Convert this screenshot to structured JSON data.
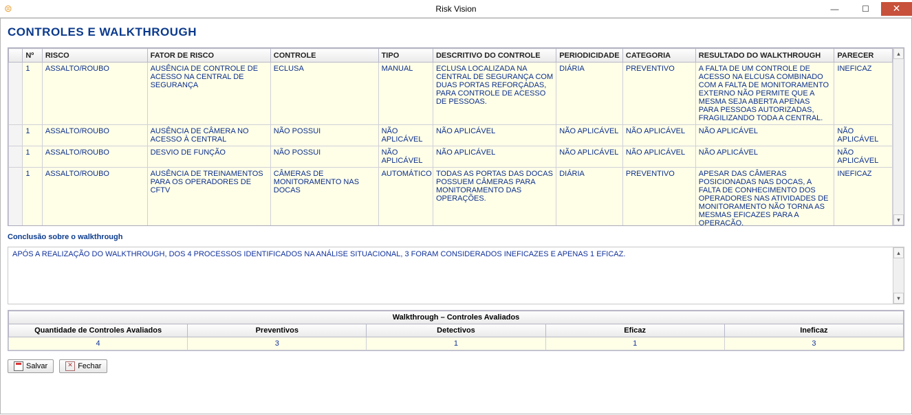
{
  "window": {
    "title": "Risk Vision"
  },
  "page": {
    "title": "CONTROLES E WALKTHROUGH"
  },
  "grid": {
    "headers": {
      "no": "Nº",
      "risco": "RISCO",
      "fator": "FATOR DE RISCO",
      "controle": "CONTROLE",
      "tipo": "TIPO",
      "descritivo": "DESCRITIVO DO CONTROLE",
      "periodicidade": "PERIODICIDADE",
      "categoria": "CATEGORIA",
      "resultado": "RESULTADO DO WALKTHROUGH",
      "parecer": "PARECER"
    },
    "rows": [
      {
        "no": "1",
        "risco": "ASSALTO/ROUBO",
        "fator": "AUSÊNCIA DE CONTROLE DE ACESSO NA CENTRAL DE SEGURANÇA",
        "controle": "ECLUSA",
        "tipo": "MANUAL",
        "descritivo": "ECLUSA LOCALIZADA NA CENTRAL DE SEGURANÇA COM DUAS PORTAS REFORÇADAS, PARA CONTROLE DE ACESSO DE PESSOAS.",
        "periodicidade": "DIÁRIA",
        "categoria": "PREVENTIVO",
        "resultado": "A FALTA DE UM CONTROLE DE ACESSO NA ELCUSA COMBINADO COM A FALTA DE MONITORAMENTO EXTERNO NÃO PERMITE QUE A MESMA SEJA ABERTA APENAS PARA PESSOAS AUTORIZADAS, FRAGILIZANDO TODA A CENTRAL.",
        "parecer": "INEFICAZ"
      },
      {
        "no": "1",
        "risco": "ASSALTO/ROUBO",
        "fator": "AUSÊNCIA DE CÂMERA NO ACESSO À CENTRAL",
        "controle": "NÃO POSSUI",
        "tipo": "NÃO APLICÁVEL",
        "descritivo": "NÃO APLICÁVEL",
        "periodicidade": "NÃO APLICÁVEL",
        "categoria": "NÃO APLICÁVEL",
        "resultado": "NÃO APLICÁVEL",
        "parecer": "NÃO APLICÁVEL"
      },
      {
        "no": "1",
        "risco": "ASSALTO/ROUBO",
        "fator": "DESVIO DE FUNÇÃO",
        "controle": "NÃO POSSUI",
        "tipo": "NÃO APLICÁVEL",
        "descritivo": "NÃO APLICÁVEL",
        "periodicidade": "NÃO APLICÁVEL",
        "categoria": "NÃO APLICÁVEL",
        "resultado": "NÃO APLICÁVEL",
        "parecer": "NÃO APLICÁVEL"
      },
      {
        "no": "1",
        "risco": "ASSALTO/ROUBO",
        "fator": "AUSÊNCIA DE TREINAMENTOS PARA OS OPERADORES DE CFTV",
        "controle": "CÂMERAS DE MONITORAMENTO NAS DOCAS",
        "tipo": "AUTOMÁTICO",
        "descritivo": "TODAS AS PORTAS DAS DOCAS POSSUEM CÂMERAS PARA MONITORAMENTO DAS OPERAÇÕES.",
        "periodicidade": "DIÁRIA",
        "categoria": "PREVENTIVO",
        "resultado": "APESAR DAS CÂMERAS POSICIONADAS NAS DOCAS, A FALTA DE CONHECIMENTO DOS OPERADORES NAS ATIVIDADES DE MONITORAMENTO NÃO TORNA AS MESMAS EFICAZES PARA A OPERAÇÃO.",
        "parecer": "INEFICAZ"
      }
    ]
  },
  "conclusion": {
    "label": "Conclusão sobre o walkthrough",
    "text": "APÓS A REALIZAÇÃO DO WALKTHROUGH, DOS 4 PROCESSOS IDENTIFICADOS NA ANÁLISE SITUACIONAL, 3 FORAM CONSIDERADOS INEFICAZES E APENAS 1 EFICAZ."
  },
  "summary": {
    "caption": "Walkthrough – Controles Avaliados",
    "headers": {
      "qtd": "Quantidade de Controles Avaliados",
      "preventivos": "Preventivos",
      "detectivos": "Detectivos",
      "eficaz": "Eficaz",
      "ineficaz": "Ineficaz"
    },
    "values": {
      "qtd": "4",
      "preventivos": "3",
      "detectivos": "1",
      "eficaz": "1",
      "ineficaz": "3"
    }
  },
  "buttons": {
    "save": "Salvar",
    "close": "Fechar"
  }
}
